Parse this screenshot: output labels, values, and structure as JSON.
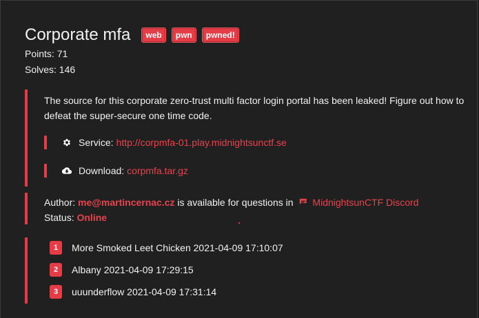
{
  "challenge": {
    "title": "Corporate mfa",
    "tags": [
      "web",
      "pwn",
      "pwned!"
    ],
    "points": "Points: 71",
    "solves": "Solves: 146"
  },
  "description": "The source for this corporate zero-trust multi factor login portal has been leaked! Figure out how to defeat the super-secure one time code.",
  "service": {
    "label": "Service:",
    "url": "http://corpmfa-01.play.midnightsunctf.se",
    "icon": "gear-icon"
  },
  "download": {
    "label": "Download:",
    "file": "corpmfa.tar.gz",
    "icon": "cloud-download-icon"
  },
  "author": {
    "prefix": "Author:",
    "email": "me@martincernac.cz",
    "middle": "is available for questions in",
    "discord": "MidnightsunCTF Discord",
    "status_label": "Status:",
    "status_value": "Online",
    "chat_icon": "chat-icon"
  },
  "solvers": [
    {
      "rank": "1",
      "text": "More Smoked Leet Chicken 2021-04-09 17:10:07"
    },
    {
      "rank": "2",
      "text": "Albany 2021-04-09 17:29:15"
    },
    {
      "rank": "3",
      "text": "uuunderflow 2021-04-09 17:31:14"
    }
  ],
  "colors": {
    "accent": "#e63c47",
    "background": "#202020",
    "text": "#f2f2f2"
  }
}
